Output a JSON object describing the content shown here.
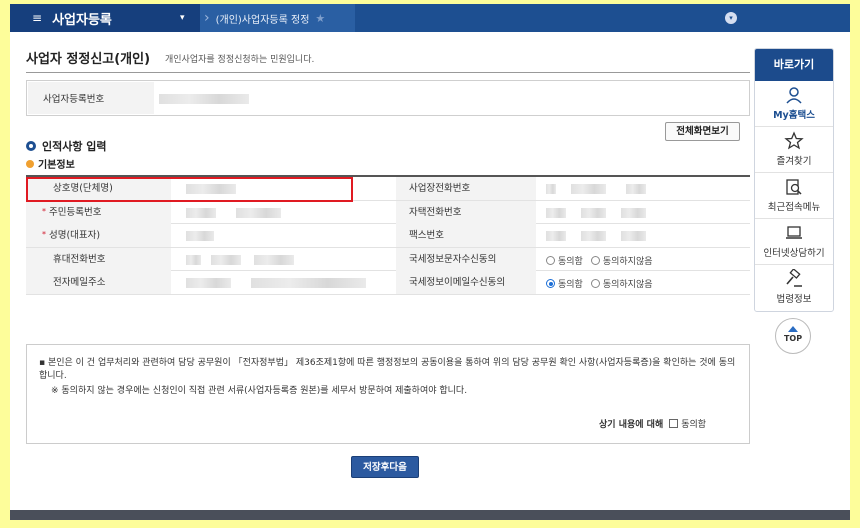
{
  "nav": {
    "menu_icon": "≡",
    "section_title": "사업자등록",
    "dropdown_icon": "▾",
    "breadcrumb": "(개인)사업자등록 정정",
    "star_icon": "★",
    "toggle_icon": "▾"
  },
  "page": {
    "title": "사업자 정정신고(개인)",
    "description": "개인사업자를 정정신청하는 민원입니다."
  },
  "registration": {
    "label": "사업자등록번호"
  },
  "section": {
    "title": "인적사항 입력",
    "fullscreen_label": "전체화면보기",
    "subsection_title": "기본정보"
  },
  "form": {
    "required_mark": "*",
    "rows": [
      {
        "left_label": "상호명(단체명)",
        "left_required": false,
        "right_label": "사업장전화번호"
      },
      {
        "left_label": "주민등록번호",
        "left_required": true,
        "right_label": "자택전화번호"
      },
      {
        "left_label": "성명(대표자)",
        "left_required": true,
        "right_label": "팩스번호"
      },
      {
        "left_label": "휴대전화번호",
        "left_required": false,
        "right_label": "국세정보문자수신동의"
      },
      {
        "left_label": "전자메일주소",
        "left_required": false,
        "right_label": "국세정보이메일수신동의"
      }
    ],
    "sms_consent": {
      "agree": "동의함",
      "disagree": "동의하지않음",
      "selected": "none"
    },
    "email_consent": {
      "agree": "동의함",
      "disagree": "동의하지않음",
      "selected": "agree"
    }
  },
  "consent": {
    "line1": "▪ 본인은 이 건 업무처리와 관련하여 담당 공무원이 「전자정부법」 제36조제1항에 따른 행정정보의 공동이용을 통하여 위의 담당 공무원 확인 사항(사업자등록증)을 확인하는 것에 동의합니다.",
    "line2": "※  동의하지 않는 경우에는 신청인이 직접 관련 서류(사업자등록증 원본)를 세무서 방문하여 제출하여야 합니다.",
    "agree_label": "상기 내용에 대해",
    "agree_checkbox": "동의함"
  },
  "buttons": {
    "save_next": "저장후다음"
  },
  "quick": {
    "header": "바로가기",
    "items": [
      {
        "label": "My홈택스",
        "icon": "user-icon"
      },
      {
        "label": "즐겨찾기",
        "icon": "star-icon"
      },
      {
        "label": "최근접속메뉴",
        "icon": "search-document-icon"
      },
      {
        "label": "인터넷상담하기",
        "icon": "laptop-icon"
      },
      {
        "label": "법령정보",
        "icon": "gavel-icon"
      }
    ],
    "top_label": "TOP"
  },
  "colors": {
    "nav_bg": "#1d4f91",
    "highlight": "#e01a22",
    "required": "#d0192c",
    "button_bg": "#2c5aa0",
    "page_bg": "#fdfd9a"
  }
}
